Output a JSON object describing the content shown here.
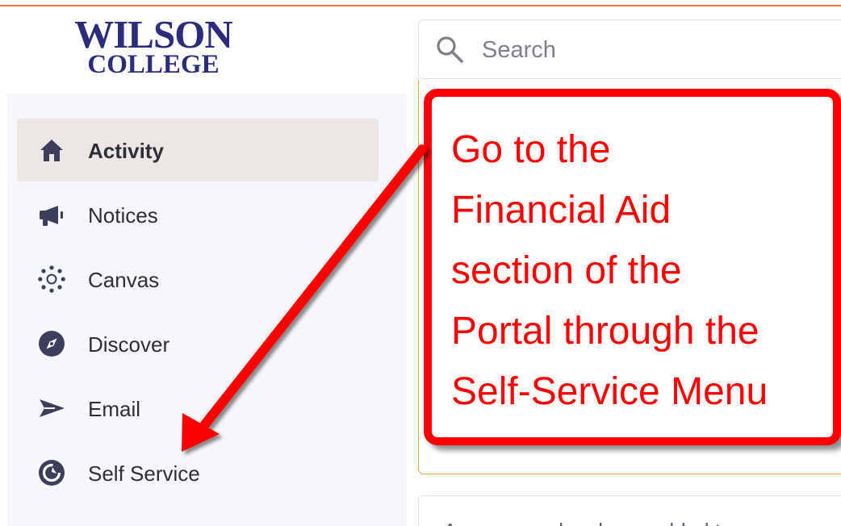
{
  "brand": {
    "line_1": "WILSON",
    "line_2": "COLLEGE"
  },
  "search": {
    "placeholder": "Search",
    "value": ""
  },
  "sidebar": {
    "items": [
      {
        "label": "Activity",
        "icon": "home-icon",
        "active": true
      },
      {
        "label": "Notices",
        "icon": "megaphone-icon",
        "active": false
      },
      {
        "label": "Canvas",
        "icon": "canvas-icon",
        "active": false
      },
      {
        "label": "Discover",
        "icon": "compass-icon",
        "active": false
      },
      {
        "label": "Email",
        "icon": "send-icon",
        "active": false
      },
      {
        "label": "Self Service",
        "icon": "self-service-icon",
        "active": false
      }
    ]
  },
  "callout": {
    "lines": [
      "Go to the",
      "Financial Aid",
      "section of the",
      "Portal through the",
      "Self-Service Menu"
    ]
  },
  "card": {
    "preview": "A new page has been added to your m"
  },
  "colors": {
    "brand": "#2b2d7c",
    "accent_rule": "#e8763a",
    "card_border": "#e9a64d",
    "annotation": "#ff0000",
    "icon": "#3b3f5c",
    "active_nav_background": "#ece7e4"
  }
}
